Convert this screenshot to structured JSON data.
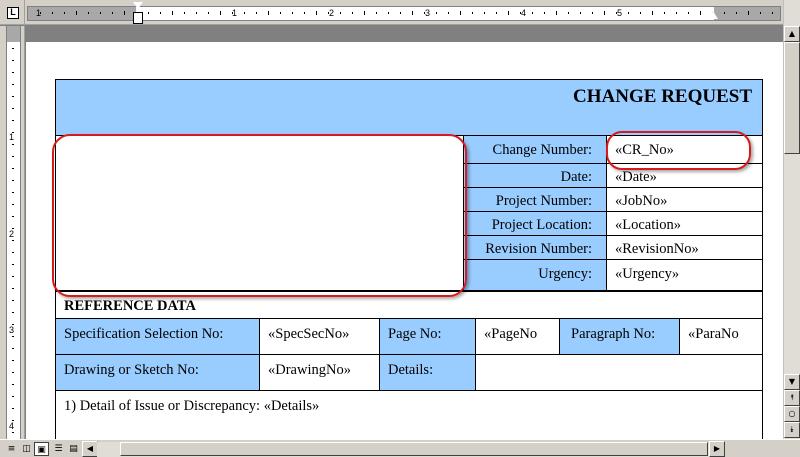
{
  "ruler": {
    "tab_selector": "L",
    "h_labels": [
      "1",
      "1",
      "2",
      "3",
      "4",
      "5"
    ],
    "v_labels": [
      "1",
      "2",
      "3",
      "4"
    ]
  },
  "document": {
    "title": "CHANGE REQUEST",
    "fields": [
      {
        "label": "Change Number:",
        "value": "«CR_No»"
      },
      {
        "label": "Date:",
        "value": "«Date»"
      },
      {
        "label": "Project Number:",
        "value": "«JobNo»"
      },
      {
        "label": "Project Location:",
        "value": "«Location»"
      },
      {
        "label": "Revision Number:",
        "value": "«RevisionNo»"
      },
      {
        "label": "Urgency:",
        "value": "«Urgency»"
      }
    ],
    "reference_heading": "REFERENCE DATA",
    "spec_label": "Specification Selection No:",
    "spec_value": "«SpecSecNo»",
    "page_label": "Page No:",
    "page_value": "«PageNo",
    "para_label": "Paragraph No:",
    "para_value": "«ParaNo",
    "drawing_label": "Drawing or Sketch No:",
    "drawing_value": "«DrawingNo»",
    "details_label": "Details:",
    "detail_line": "1) Detail of Issue or Discrepancy:  «Details»"
  },
  "colors": {
    "table_fill": "#99ccff",
    "highlight": "#d81a1a"
  },
  "scrollbar": {
    "up": "▲",
    "down": "▼",
    "prev_page": "⯭",
    "select_browse": "○",
    "next_page": "⯯",
    "left": "◀",
    "right": "▶"
  },
  "view_buttons": [
    "normal-view",
    "web-layout-view",
    "print-layout-view",
    "outline-view",
    "reading-view"
  ]
}
